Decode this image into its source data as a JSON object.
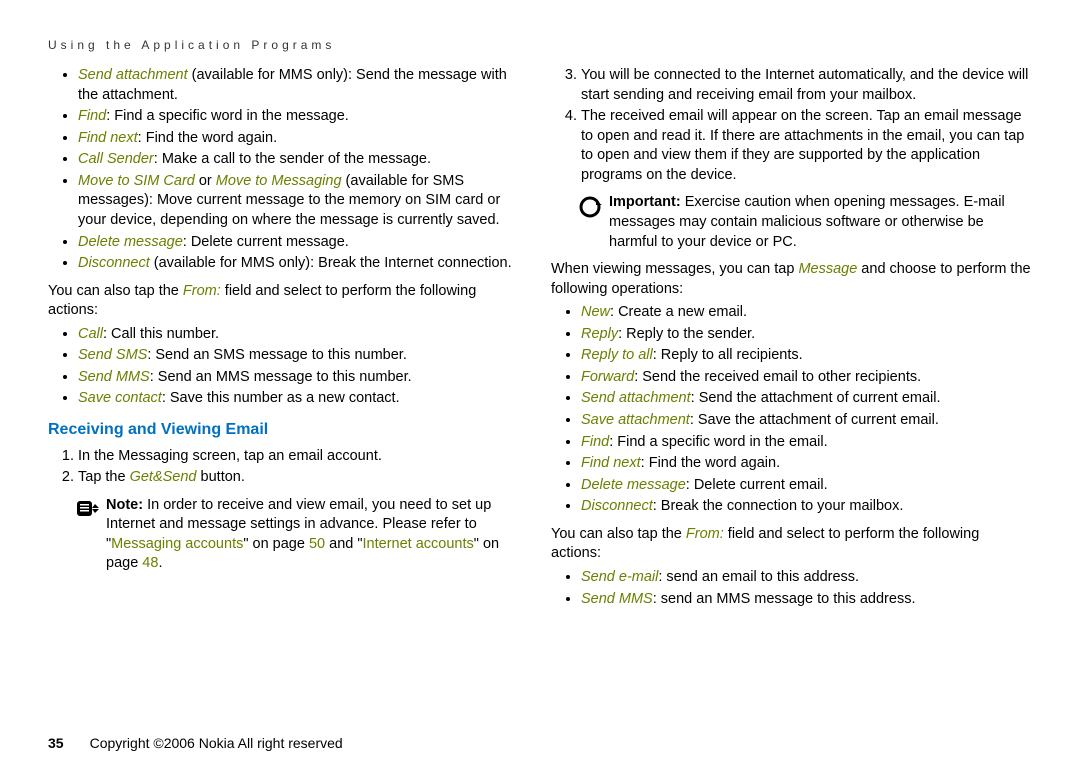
{
  "header": "Using the Application Programs",
  "left": {
    "bl1": [
      {
        "term": "Send attachment",
        "text": " (available for MMS only): Send the message with the attachment."
      },
      {
        "term": "Find",
        "text": ": Find a specific word in the message."
      },
      {
        "term": "Find next",
        "text": ": Find the word again."
      },
      {
        "term": "Call Sender",
        "text": ": Make a call to the sender of the message."
      },
      {
        "term": "Move to SIM Card",
        "mid": " or ",
        "term2": "Move to Messaging",
        "text": " (available for SMS messages): Move current message to the memory on SIM card or your device, depending on where the message is currently saved."
      },
      {
        "term": "Delete message",
        "text": ": Delete current message."
      },
      {
        "term": "Disconnect",
        "text": " (available for MMS only): Break the Internet connection."
      }
    ],
    "p1a": "You can also tap the ",
    "p1term": "From:",
    "p1b": " field and select to perform the following actions:",
    "bl2": [
      {
        "term": "Call",
        "text": ": Call this number."
      },
      {
        "term": "Send SMS",
        "text": ": Send an SMS message to this number."
      },
      {
        "term": "Send MMS",
        "text": ": Send an MMS message to this number."
      },
      {
        "term": "Save contact",
        "text": ": Save this number as a new contact."
      }
    ],
    "subhead": "Receiving and Viewing Email",
    "ol": [
      "In the Messaging screen, tap an email account.",
      "Tap the "
    ],
    "ol2term": "Get&Send",
    "ol2tail": " button.",
    "note_label": "Note:",
    "note_body_a": " In order to receive and view email, you need to set up Internet and message settings in advance. Please refer to \"",
    "note_link1": "Messaging accounts",
    "note_mid1": "\" on page ",
    "note_pg1": "50",
    "note_mid2": " and \"",
    "note_link2": "Internet accounts",
    "note_mid3": "\" on page ",
    "note_pg2": "48",
    "note_tail": "."
  },
  "right": {
    "ol": [
      "You will be connected to the Internet automatically, and the device will start sending and receiving email from your mailbox.",
      "The received email will appear on the screen. Tap an email message to open and read it. If there are attachments in the email, you can tap to open and view them if they are supported by the application programs on the device."
    ],
    "imp_label": "Important:",
    "imp_body": " Exercise caution when opening messages. E-mail messages may contain malicious software or otherwise be harmful to your device or PC.",
    "p2a": "When viewing messages, you can tap ",
    "p2term": "Message",
    "p2b": " and choose to perform the following operations:",
    "bl": [
      {
        "term": "New",
        "text": ": Create a new email."
      },
      {
        "term": "Reply",
        "text": ": Reply to the sender."
      },
      {
        "term": "Reply to all",
        "text": ": Reply to all recipients."
      },
      {
        "term": "Forward",
        "text": ": Send the received email to other recipients."
      },
      {
        "term": "Send attachment",
        "text": ": Send the attachment of current email."
      },
      {
        "term": "Save attachment",
        "text": ": Save the attachment of current email."
      },
      {
        "term": "Find",
        "text": ": Find a specific word in the email."
      },
      {
        "term": "Find next",
        "text": ": Find the word again."
      },
      {
        "term": "Delete message",
        "text": ": Delete current email."
      },
      {
        "term": "Disconnect",
        "text": ": Break the connection to your mailbox."
      }
    ],
    "p3a": "You can also tap the ",
    "p3term": "From:",
    "p3b": " field and select to perform the following actions:",
    "bl2": [
      {
        "term": "Send e-mail",
        "text": ": send an email to this address."
      },
      {
        "term": "Send MMS",
        "text": ": send an MMS message to this address."
      }
    ]
  },
  "footer_pg": "35",
  "footer_text": "Copyright ©2006 Nokia All right reserved"
}
